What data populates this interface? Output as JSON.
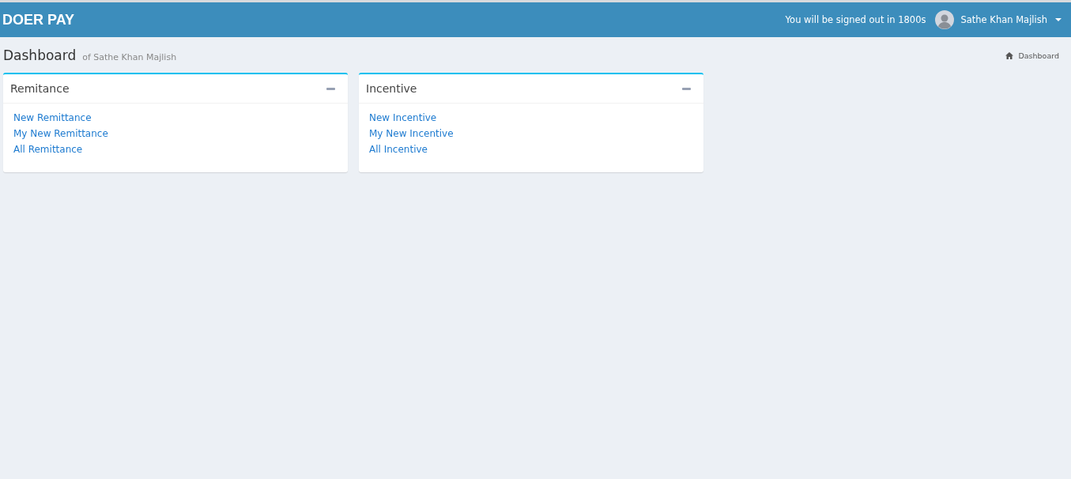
{
  "header": {
    "logo": "DOER PAY",
    "session_notice": "You will be signed out in 1800s",
    "user_name": "Sathe Khan Majlish"
  },
  "page": {
    "title": "Dashboard",
    "subtitle": "of Sathe Khan Majlish",
    "breadcrumb": "Dashboard"
  },
  "boxes": [
    {
      "title": "Remitance",
      "links": [
        "New Remittance",
        "My New Remittance",
        "All Remittance"
      ]
    },
    {
      "title": "Incentive",
      "links": [
        "New Incentive",
        "My New Incentive",
        "All Incentive"
      ]
    }
  ]
}
